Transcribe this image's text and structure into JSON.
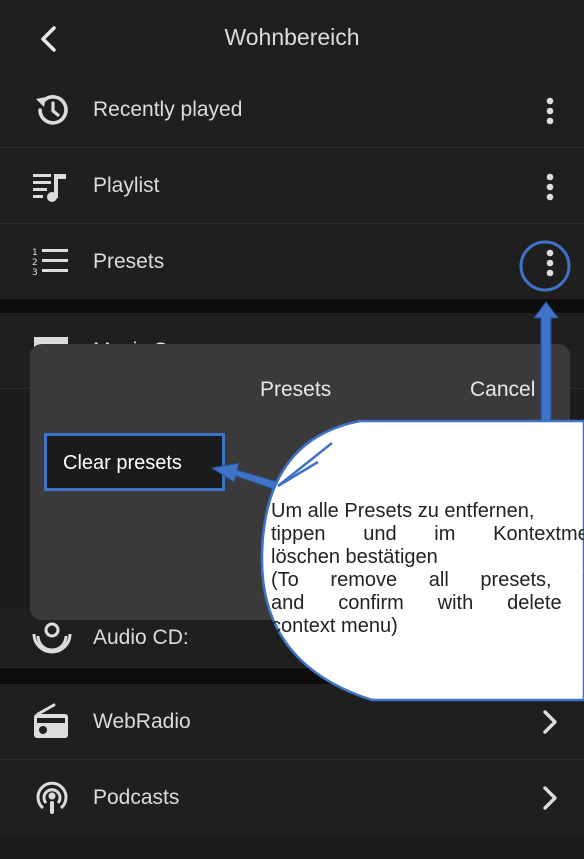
{
  "header": {
    "title": "Wohnbereich",
    "back_icon": "chevron-left-icon"
  },
  "rows": [
    {
      "label": "Recently played",
      "icon": "history-icon",
      "action": "more-vertical-icon"
    },
    {
      "label": "Playlist",
      "icon": "playlist-icon",
      "action": "more-vertical-icon"
    },
    {
      "label": "Presets",
      "icon": "numbered-list-icon",
      "action": "more-vertical-icon"
    },
    {
      "label": "Music Server",
      "icon": "server-icon"
    },
    {
      "label": "Audio CD:",
      "icon": "cd-icon"
    },
    {
      "label": "WebRadio",
      "icon": "radio-icon",
      "action": "chevron-right-icon"
    },
    {
      "label": "Podcasts",
      "icon": "podcast-icon",
      "action": "chevron-right-icon"
    }
  ],
  "dialog": {
    "title": "Presets",
    "cancel_label": "Cancel",
    "clear_label": "Clear presets"
  },
  "annotation": {
    "line1": "Um alle Presets zu entfernen,",
    "line2": "tippen und im Kontextmenü",
    "line3": "löschen bestätigen",
    "line4": "(To remove all presets, tap",
    "line5": "and confirm with delete in",
    "line6": "context menu)",
    "highlight_color": "#3f73c9"
  }
}
